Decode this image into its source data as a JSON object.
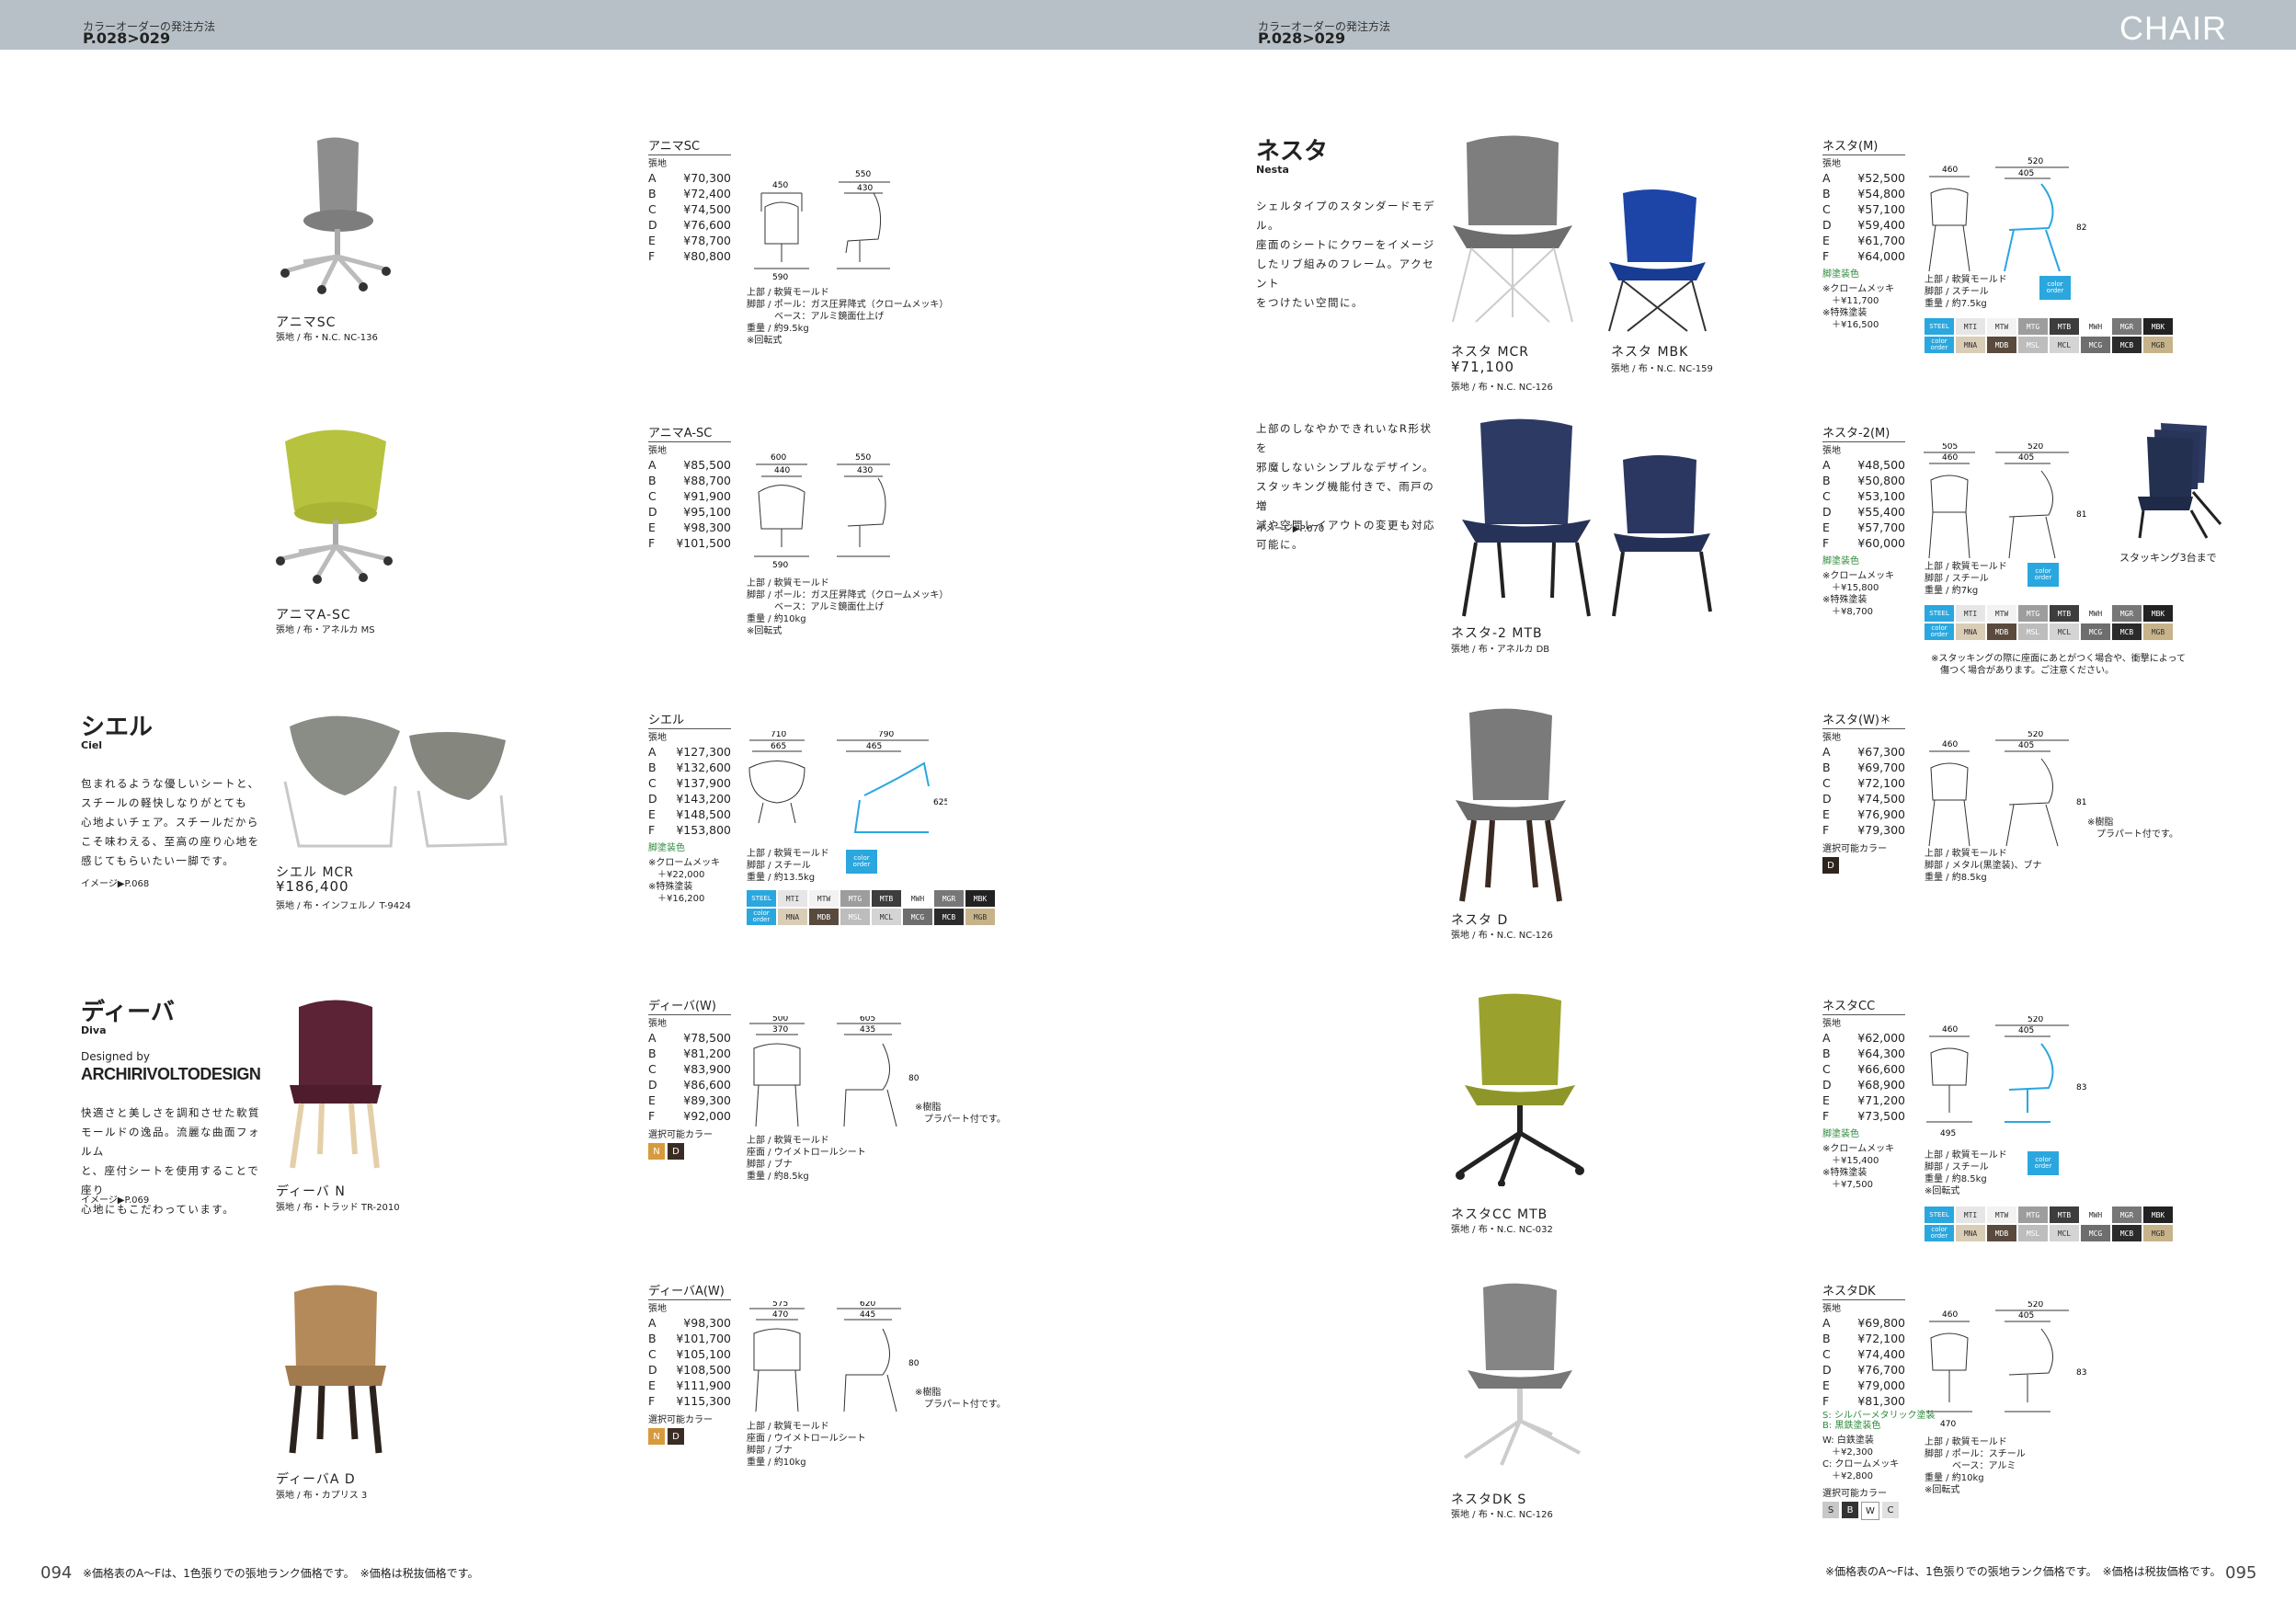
{
  "header": {
    "left_small": "カラーオーダーの発注方法",
    "left_page": "P.028>029",
    "right_small": "カラーオーダーの発注方法",
    "right_page": "P.028>029",
    "category": "CHAIR"
  },
  "series": {
    "ciel": {
      "title": "シエル",
      "sub": "Ciel",
      "desc": "包まれるような優しいシートと、\nスチールの軽快しなりがとても\n心地よいチェア。スチールだから\nこそ味わえる、至高の座り心地を\n感じてもらいたい一脚です。",
      "ref": "イメージ▶P.068"
    },
    "diva": {
      "title": "ディーバ",
      "sub": "Diva",
      "designed_by": "Designed by",
      "designer": "ARCHIRIVOLTODESIGN",
      "desc": "快適さと美しさを調和させた軟質\nモールドの逸品。流麗な曲面フォルム\nと、座付シートを使用することで座り\n心地にもこだわっています。",
      "ref": "イメージ▶P.069"
    },
    "nesta": {
      "title": "ネスタ",
      "sub": "Nesta",
      "desc": "シェルタイプのスタンダードモデル。\n座面のシートにクワーをイメージ\nしたリブ組みのフレーム。アクセント\nをつけたい空間に。",
      "desc2": "上部のしなやかできれいなR形状を\n邪魔しないシンプルなデザイン。\nスタッキング機能付きで、雨戸の増\n減や空間レイアウトの変更も対応\n可能に。",
      "ref2": "イメージ▶P.070"
    }
  },
  "captions": {
    "anima_sc": {
      "name": "アニマSC",
      "fabric": "張地 / 布・N.C. NC-136"
    },
    "anima_asc": {
      "name": "アニマA-SC",
      "fabric": "張地 / 布・アネルカ MS"
    },
    "ciel_mcr": {
      "name": "シエル MCR",
      "price": "¥186,400",
      "fabric": "張地 / 布・インフェルノ T-9424"
    },
    "diva_n": {
      "name": "ディーバ N",
      "fabric": "張地 / 布・トラッド TR-2010"
    },
    "diva_ad": {
      "name": "ディーバA D",
      "fabric": "張地 / 布・カプリス 3"
    },
    "nesta_mcr": {
      "name": "ネスタ MCR",
      "price": "¥71,100",
      "fabric": "張地 / 布・N.C. NC-126"
    },
    "nesta_mbk": {
      "name": "ネスタ MBK",
      "fabric": "張地 / 布・N.C. NC-159"
    },
    "nesta2_mtb": {
      "name": "ネスタ-2 MTB",
      "fabric": "張地 / 布・アネルカ DB"
    },
    "nesta_d": {
      "name": "ネスタ D",
      "fabric": "張地 / 布・N.C. NC-126"
    },
    "nestacc_mtb": {
      "name": "ネスタCC MTB",
      "fabric": "張地 / 布・N.C. NC-032"
    },
    "nestadk_s": {
      "name": "ネスタDK S",
      "fabric": "張地 / 布・N.C. NC-126"
    }
  },
  "grades": [
    "A",
    "B",
    "C",
    "D",
    "E",
    "F"
  ],
  "price_label": "張地",
  "products": {
    "anima_sc": {
      "title": "アニマSC",
      "prices": [
        "¥70,300",
        "¥72,400",
        "¥74,500",
        "¥76,600",
        "¥78,700",
        "¥80,800"
      ],
      "dims": [
        "450",
        "550",
        "430",
        "590"
      ],
      "notes": "上部 / 軟質モールド\n脚部 / ポール：ガス圧昇降式（クロームメッキ）\n　　　ベース：アルミ鏡面仕上げ\n重量 / 約9.5kg\n※回転式"
    },
    "anima_asc": {
      "title": "アニマA-SC",
      "prices": [
        "¥85,500",
        "¥88,700",
        "¥91,900",
        "¥95,100",
        "¥98,300",
        "¥101,500"
      ],
      "dims": [
        "600",
        "440",
        "550",
        "430",
        "590"
      ],
      "notes": "上部 / 軟質モールド\n脚部 / ポール：ガス圧昇降式（クロームメッキ）\n　　　ベース：アルミ鏡面仕上げ\n重量 / 約10kg\n※回転式"
    },
    "ciel": {
      "title": "シエル",
      "prices": [
        "¥127,300",
        "¥132,600",
        "¥137,900",
        "¥143,200",
        "¥148,500",
        "¥153,800"
      ],
      "dims": [
        "710",
        "665",
        "790",
        "465",
        "625"
      ],
      "green": "脚塗装色",
      "opts": "※クロームメッキ\n　＋¥22,000\n※特殊塗装\n　＋¥16,200",
      "notes": "上部 / 軟質モールド\n脚部 / スチール\n重量 / 約13.5kg"
    },
    "diva": {
      "title": "ディーバ(W)",
      "prices": [
        "¥78,500",
        "¥81,200",
        "¥83,900",
        "¥86,600",
        "¥89,300",
        "¥92,000"
      ],
      "dims": [
        "500",
        "370",
        "605",
        "435",
        "805"
      ],
      "sel_label": "選択可能カラー",
      "side_note": "※樹脂\n　プラパート付です。",
      "notes": "上部 / 軟質モールド\n座面 / ウイメトロールシート\n脚部 / ブナ\n重量 / 約8.5kg"
    },
    "diva_a": {
      "title": "ディーバA(W)",
      "prices": [
        "¥98,300",
        "¥101,700",
        "¥105,100",
        "¥108,500",
        "¥111,900",
        "¥115,300"
      ],
      "dims": [
        "575",
        "470",
        "620",
        "445",
        "805"
      ],
      "sel_label": "選択可能カラー",
      "side_note": "※樹脂\n　プラパート付です。",
      "notes": "上部 / 軟質モールド\n座面 / ウイメトロールシート\n脚部 / ブナ\n重量 / 約10kg"
    },
    "nesta_m": {
      "title": "ネスタ(M)",
      "prices": [
        "¥52,500",
        "¥54,800",
        "¥57,100",
        "¥59,400",
        "¥61,700",
        "¥64,000"
      ],
      "dims": [
        "460",
        "520",
        "405",
        "820"
      ],
      "green": "脚塗装色",
      "opts": "※クロームメッキ\n　＋¥11,700\n※特殊塗装\n　＋¥16,500",
      "notes": "上部 / 軟質モールド\n脚部 / スチール\n重量 / 約7.5kg"
    },
    "nesta2_m": {
      "title": "ネスタ-2(M)",
      "prices": [
        "¥48,500",
        "¥50,800",
        "¥53,100",
        "¥55,400",
        "¥57,700",
        "¥60,000"
      ],
      "dims": [
        "505",
        "460",
        "520",
        "405",
        "810"
      ],
      "green": "脚塗装色",
      "opts": "※クロームメッキ\n　＋¥15,800\n※特殊塗装\n　＋¥8,700",
      "notes": "上部 / 軟質モールド\n脚部 / スチール\n重量 / 約7kg",
      "stack": "スタッキング3台まで",
      "stack_note": "※スタッキングの際に座面にあとがつく場合や、衝撃によって\n　傷つく場合があります。ご注意ください。"
    },
    "nesta_w": {
      "title": "ネスタ(W)＊",
      "prices": [
        "¥67,300",
        "¥69,700",
        "¥72,100",
        "¥74,500",
        "¥76,900",
        "¥79,300"
      ],
      "dims": [
        "460",
        "520",
        "405",
        "810"
      ],
      "sel_label": "選択可能カラー",
      "side_note": "※樹脂\n　プラパート付です。",
      "notes": "上部 / 軟質モールド\n脚部 / メタル(黒塗装)、ブナ\n重量 / 約8.5kg"
    },
    "nesta_cc": {
      "title": "ネスタCC",
      "prices": [
        "¥62,000",
        "¥64,300",
        "¥66,600",
        "¥68,900",
        "¥71,200",
        "¥73,500"
      ],
      "dims": [
        "460",
        "520",
        "405",
        "830",
        "495"
      ],
      "green": "脚塗装色",
      "opts": "※クロームメッキ\n　＋¥15,400\n※特殊塗装\n　＋¥7,500",
      "notes": "上部 / 軟質モールド\n脚部 / スチール\n重量 / 約8.5kg\n※回転式"
    },
    "nesta_dk": {
      "title": "ネスタDK",
      "prices": [
        "¥69,800",
        "¥72,100",
        "¥74,400",
        "¥76,700",
        "¥79,000",
        "¥81,300"
      ],
      "dims": [
        "460",
        "520",
        "405",
        "830",
        "470"
      ],
      "green2": "S: シルバーメタリック塗装\nB: 黒鉄塗装色",
      "opts": "W: 白鉄塗装\n　＋¥2,300\nC: クロームメッキ\n　＋¥2,800",
      "sel_label": "選択可能カラー",
      "notes": "上部 / 軟質モールド\n脚部 / ポール：スチール\n　　　ベース：アルミ\n重量 / 約10kg\n※回転式"
    }
  },
  "swatches": {
    "steel_label": "STEEL",
    "color_order": "color order",
    "row1": [
      {
        "code": "MTI",
        "color": "#e6e6e6"
      },
      {
        "code": "MTW",
        "color": "#f2f2f2"
      },
      {
        "code": "MTG",
        "color": "#9d9d9d"
      },
      {
        "code": "MTB",
        "color": "#3d3d3d"
      },
      {
        "code": "MWH",
        "color": "#ffffff"
      },
      {
        "code": "MGR",
        "color": "#777777"
      },
      {
        "code": "MBK",
        "color": "#222222"
      }
    ],
    "row2": [
      {
        "code": "MNA",
        "color": "#d9cdb6"
      },
      {
        "code": "MDB",
        "color": "#5a4a3e"
      },
      {
        "code": "MSL",
        "color": "#bdbdbd"
      },
      {
        "code": "MCL",
        "color": "#d4d4d4"
      },
      {
        "code": "MCG",
        "color": "#6e6e6e"
      },
      {
        "code": "MCB",
        "color": "#2b2b2b"
      },
      {
        "code": "MGB",
        "color": "#c7b38a"
      }
    ]
  },
  "colors": {
    "accent": "#2aa7df",
    "header_band": "#b6c0c6",
    "green": "#2d8a3c"
  },
  "opt_colors": {
    "diva": [
      {
        "code": "N",
        "color": "#d79a3c"
      },
      {
        "code": "D",
        "color": "#3a2c24"
      }
    ],
    "nesta_w": [
      {
        "code": "D",
        "color": "#2e241e"
      }
    ],
    "nesta_dk": [
      {
        "code": "S",
        "color": "#c8c8c8"
      },
      {
        "code": "B",
        "color": "#333333"
      },
      {
        "code": "W",
        "color": "#ffffff"
      },
      {
        "code": "C",
        "color": "#e0e0e0"
      }
    ]
  },
  "footer": {
    "left_num": "094",
    "right_num": "095",
    "left_note": "※価格表のA〜Fは、1色張りでの張地ランク価格です。　※価格は税抜価格です。",
    "right_note": "※価格表のA〜Fは、1色張りでの張地ランク価格です。　※価格は税抜価格です。"
  }
}
